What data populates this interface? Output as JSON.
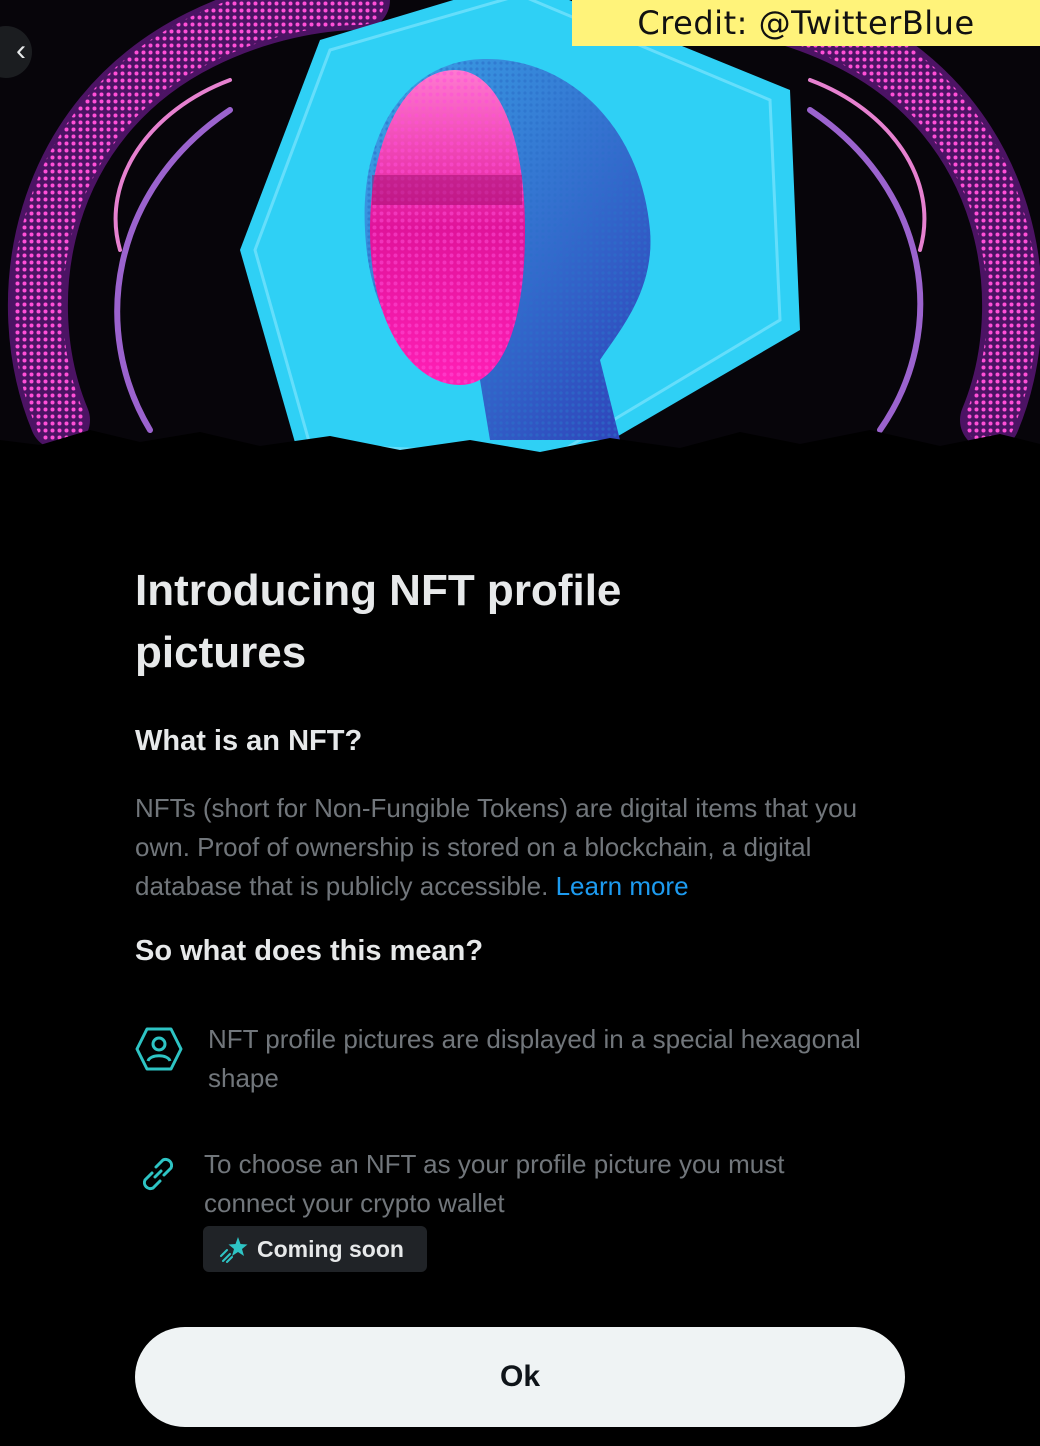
{
  "credit": "Credit: @TwitterBlue",
  "modal": {
    "title": "Introducing NFT profile pictures",
    "section1": {
      "heading": "What is an NFT?",
      "body": "NFTs (short for Non-Fungible Tokens) are digital items that you own. Proof of ownership is stored on a blockchain, a digital database that is publicly accessible.",
      "link": "Learn more"
    },
    "section2": {
      "heading": "So what does this mean?",
      "items": [
        {
          "icon": "hexagon-profile-icon",
          "text": "NFT profile pictures are displayed in a special hexagonal shape"
        },
        {
          "icon": "link-icon",
          "text": "To choose an NFT as your profile picture you must connect your crypto wallet",
          "badge": "Coming soon",
          "badge_icon": "sparkle-star-icon"
        }
      ]
    },
    "ok_label": "Ok"
  },
  "colors": {
    "background": "#000000",
    "heading": "#e7e9ea",
    "body_text": "#71767b",
    "link": "#1d9bf0",
    "accent_teal": "#2ec4c4",
    "credit_bg": "#fff37a",
    "button_bg": "#eff3f4"
  }
}
